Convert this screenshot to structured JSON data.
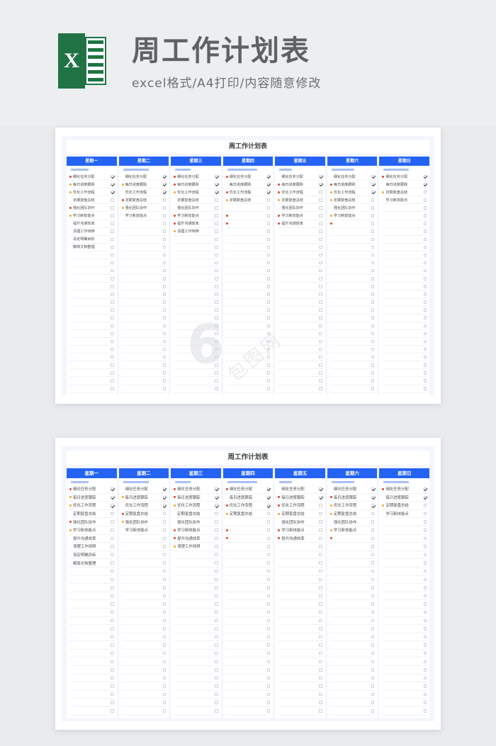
{
  "banner": {
    "logo_letter": "X",
    "logo_name": "excel-logo",
    "title": "周工作计划表",
    "subtitle": "excel格式/A4打印/内容随意修改"
  },
  "colors": {
    "header_blue": "#2563f5",
    "bar_blue": "#a8c0f7",
    "dot_red": "#e8402a",
    "dot_orange": "#f5a623",
    "sheet_bg": "#f4f6fd",
    "page_bg": "#e9ebed",
    "logo_green": "#217346"
  },
  "watermark": {
    "numeral": "6",
    "label": "包图网"
  },
  "sheet": {
    "title": "周工作计划表",
    "total_rows": 28,
    "columns": [
      {
        "day": "星期一",
        "bar_width_pct": 42,
        "tasks": [
          {
            "text": "细化任务分配",
            "dot": "red",
            "checked": true
          },
          {
            "text": "每日进度跟踪",
            "dot": "orange",
            "checked": true
          },
          {
            "text": "优化工作流程",
            "dot": "orange",
            "checked": true
          },
          {
            "text": "定期复盘总结",
            "dot": "none",
            "checked": false
          },
          {
            "text": "强化团队协作",
            "dot": "red",
            "checked": false
          },
          {
            "text": "学习新技能点",
            "dot": "orange",
            "checked": false
          },
          {
            "text": "提升沟通效率",
            "dot": "none",
            "checked": false
          },
          {
            "text": "清理工作待辨",
            "dot": "none",
            "checked": false
          },
          {
            "text": "设定明确目标",
            "dot": "none",
            "checked": false
          },
          {
            "text": "精简文档整理",
            "dot": "none",
            "checked": false
          }
        ]
      },
      {
        "day": "星期二",
        "bar_width_pct": 62,
        "tasks": [
          {
            "text": "细化任务分配",
            "dot": "none",
            "checked": true
          },
          {
            "text": "每日进度跟踪",
            "dot": "orange",
            "checked": true
          },
          {
            "text": "优化工作流程",
            "dot": "none",
            "checked": true
          },
          {
            "text": "定期复盘总结",
            "dot": "red",
            "checked": false
          },
          {
            "text": "强化团队协作",
            "dot": "orange",
            "checked": false
          },
          {
            "text": "学习新技能点",
            "dot": "none",
            "checked": false
          }
        ]
      },
      {
        "day": "星期三",
        "bar_width_pct": 38,
        "tasks": [
          {
            "text": "细化任务分配",
            "dot": "red",
            "checked": true
          },
          {
            "text": "每日进度跟踪",
            "dot": "red",
            "checked": true
          },
          {
            "text": "优化工作流程",
            "dot": "orange",
            "checked": true
          },
          {
            "text": "定期复盘总结",
            "dot": "none",
            "checked": false
          },
          {
            "text": "强化团队协作",
            "dot": "none",
            "checked": false
          },
          {
            "text": "学习新技能点",
            "dot": "red",
            "checked": false
          },
          {
            "text": "提升沟通效率",
            "dot": "red",
            "checked": false
          },
          {
            "text": "清理工作待辨",
            "dot": "orange",
            "checked": false
          }
        ]
      },
      {
        "day": "星期四",
        "bar_width_pct": 72,
        "tasks": [
          {
            "text": "细化任务分配",
            "dot": "red",
            "checked": true
          },
          {
            "text": "每日进度跟踪",
            "dot": "none",
            "checked": true
          },
          {
            "text": "优化工作流程",
            "dot": "red",
            "checked": true
          },
          {
            "text": "定期复盘总结",
            "dot": "orange",
            "checked": false
          },
          {
            "text": "",
            "dot": "none",
            "checked": false
          },
          {
            "text": "",
            "dot": "red",
            "checked": false
          },
          {
            "text": "",
            "dot": "red",
            "checked": false
          }
        ]
      },
      {
        "day": "星期五",
        "bar_width_pct": 30,
        "tasks": [
          {
            "text": "细化任务分配",
            "dot": "none",
            "checked": true
          },
          {
            "text": "每日进度跟踪",
            "dot": "red",
            "checked": true
          },
          {
            "text": "优化工作流程",
            "dot": "red",
            "checked": false
          },
          {
            "text": "定期复盘总结",
            "dot": "orange",
            "checked": false
          },
          {
            "text": "强化团队协作",
            "dot": "none",
            "checked": false
          },
          {
            "text": "学习新技能点",
            "dot": "red",
            "checked": false
          },
          {
            "text": "提升沟通效率",
            "dot": "red",
            "checked": false
          }
        ]
      },
      {
        "day": "星期六",
        "bar_width_pct": 55,
        "tasks": [
          {
            "text": "细化任务分配",
            "dot": "none",
            "checked": true
          },
          {
            "text": "每日进度跟踪",
            "dot": "red",
            "checked": true
          },
          {
            "text": "优化工作流程",
            "dot": "orange",
            "checked": true
          },
          {
            "text": "定期复盘总结",
            "dot": "orange",
            "checked": false
          },
          {
            "text": "强化团队协作",
            "dot": "none",
            "checked": false
          },
          {
            "text": "学习新技能点",
            "dot": "orange",
            "checked": false
          },
          {
            "text": "",
            "dot": "red",
            "checked": false
          }
        ]
      },
      {
        "day": "星期日",
        "bar_width_pct": 60,
        "tasks": [
          {
            "text": "细化任务分配",
            "dot": "red",
            "checked": true
          },
          {
            "text": "每日进度跟踪",
            "dot": "none",
            "checked": true
          },
          {
            "text": "定期复盘总结",
            "dot": "orange",
            "checked": false
          },
          {
            "text": "学习新技能点",
            "dot": "none",
            "checked": false
          }
        ]
      }
    ]
  }
}
